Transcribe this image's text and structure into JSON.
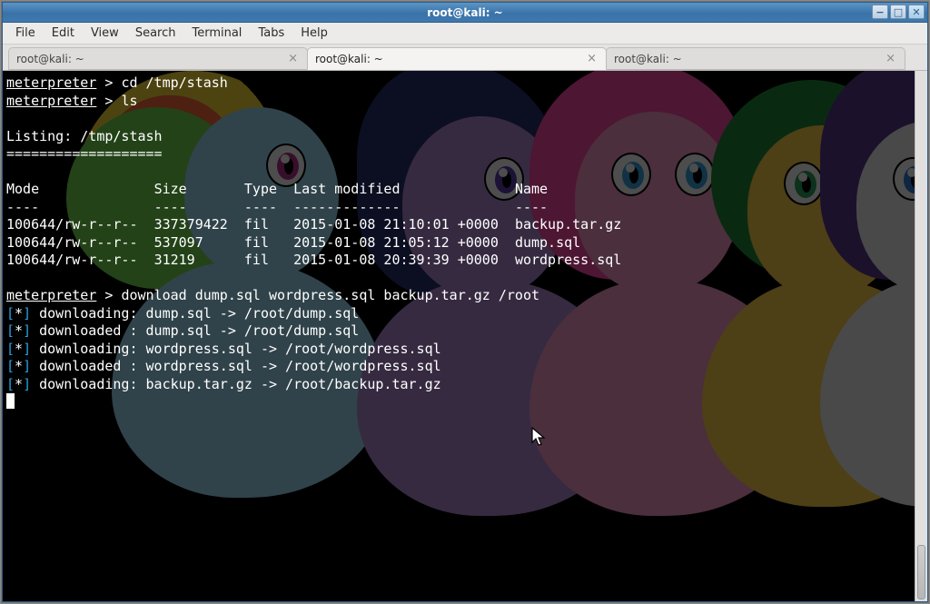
{
  "window": {
    "title": "root@kali: ~"
  },
  "menu": {
    "file": "File",
    "edit": "Edit",
    "view": "View",
    "search": "Search",
    "terminal": "Terminal",
    "tabs": "Tabs",
    "help": "Help"
  },
  "tabs": [
    {
      "label": "root@kali: ~",
      "active": false
    },
    {
      "label": "root@kali: ~",
      "active": true
    },
    {
      "label": "root@kali: ~",
      "active": false
    }
  ],
  "terminal": {
    "prompt": "meterpreter",
    "prompt_sep": " > ",
    "cmd_cd": "cd /tmp/stash",
    "cmd_ls": "ls",
    "listing_header": "Listing: /tmp/stash",
    "listing_rule": "===================",
    "columns": {
      "mode": "Mode",
      "size": "Size",
      "type": "Type",
      "last_modified": "Last modified",
      "name": "Name"
    },
    "dashes": {
      "mode": "----",
      "size": "----",
      "type": "----",
      "last_modified": "-------------",
      "name": "----"
    },
    "rows": [
      {
        "mode": "100644/rw-r--r--",
        "size": "337379422",
        "type": "fil",
        "last_modified": "2015-01-08 21:10:01 +0000",
        "name": "backup.tar.gz"
      },
      {
        "mode": "100644/rw-r--r--",
        "size": "537097",
        "type": "fil",
        "last_modified": "2015-01-08 21:05:12 +0000",
        "name": "dump.sql"
      },
      {
        "mode": "100644/rw-r--r--",
        "size": "31219",
        "type": "fil",
        "last_modified": "2015-01-08 20:39:39 +0000",
        "name": "wordpress.sql"
      }
    ],
    "cmd_download": "download dump.sql wordpress.sql backup.tar.gz /root",
    "marker_l": "[",
    "marker_star": "*",
    "marker_r": "]",
    "progress": [
      "downloading: dump.sql -> /root/dump.sql",
      "downloaded : dump.sql -> /root/dump.sql",
      "downloading: wordpress.sql -> /root/wordpress.sql",
      "downloaded : wordpress.sql -> /root/wordpress.sql",
      "downloading: backup.tar.gz -> /root/backup.tar.gz"
    ]
  },
  "win_btn": {
    "min": "−",
    "max": "□",
    "close": "✕"
  }
}
